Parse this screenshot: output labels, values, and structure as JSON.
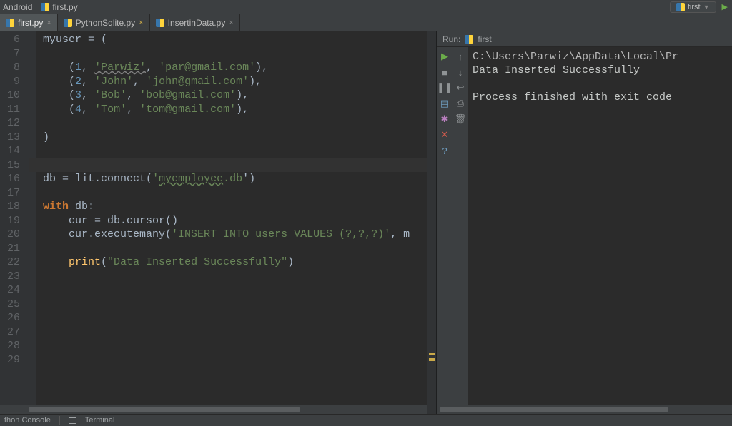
{
  "nav": {
    "breadcrumb1": "Android",
    "breadcrumb2": "first.py",
    "run_config": "first"
  },
  "tabs": [
    {
      "label": "first.py",
      "active": true
    },
    {
      "label": "PythonSqlite.py",
      "active": false
    },
    {
      "label": "InsertinData.py",
      "active": false
    }
  ],
  "editor": {
    "first_line_number": 6,
    "caret_line_index": 9
  },
  "code": {
    "l6": {
      "var": "myuser",
      "op": " = ("
    },
    "l8": {
      "open": "(",
      "n": "1",
      "s1": "'Parwiz'",
      "s2": "'par@gmail.com'",
      "close": "),"
    },
    "l9": {
      "open": "(",
      "n": "2",
      "s1": "'John'",
      "s2": "'john@gmail.com'",
      "close": "),"
    },
    "l10": {
      "open": "(",
      "n": "3",
      "s1": "'Bob'",
      "s2": "'bob@gmail.com'",
      "close": "),"
    },
    "l11": {
      "open": "(",
      "n": "4",
      "s1": "'Tom'",
      "s2": "'tom@gmail.com'",
      "close": "),"
    },
    "l13": {
      "close": ")"
    },
    "l16": {
      "var": "db",
      "eq": " = ",
      "mod": "lit",
      "dot": ".connect(",
      "sq": "'",
      "dbname": "myemployee",
      "ext": ".db",
      "eq2": "')"
    },
    "l18": {
      "kw": "with ",
      "var": "db",
      "colon": ":"
    },
    "l19": {
      "var": "cur",
      "eq": " = db.cursor()"
    },
    "l20": {
      "call": "cur.executemany(",
      "sql": "'INSERT INTO users VALUES (?,?,?)'",
      "rest": ", m"
    },
    "l22": {
      "fn": "print",
      "open": "(",
      "msg": "\"Data Inserted Successfully\"",
      "close": ")"
    }
  },
  "run": {
    "label": "Run:",
    "target": "first"
  },
  "console": {
    "l1": "C:\\Users\\Parwiz\\AppData\\Local\\Pr",
    "l2": "Data Inserted Successfully",
    "l3": "",
    "l4": "Process finished with exit code "
  },
  "bottom": {
    "item1": "thon Console",
    "item2": "Terminal"
  }
}
